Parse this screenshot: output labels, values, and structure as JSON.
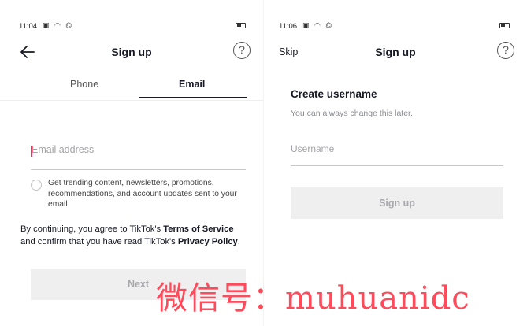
{
  "left_screen": {
    "status": {
      "time": "11:04",
      "icons": "▣ ◠ ⌬"
    },
    "header": {
      "title": "Sign up",
      "help_symbol": "?"
    },
    "tabs": [
      {
        "label": "Phone"
      },
      {
        "label": "Email"
      }
    ],
    "email": {
      "placeholder": "Email address",
      "value": ""
    },
    "consent": {
      "text": "Get trending content, newsletters, promotions, recommendations, and account updates sent to your email"
    },
    "legal": {
      "prefix": "By continuing, you agree to TikTok's ",
      "terms_link": "Terms of Service",
      "middle": " and confirm that you have read TikTok's ",
      "privacy_link": "Privacy Policy",
      "suffix": "."
    },
    "next_button": "Next"
  },
  "right_screen": {
    "status": {
      "time": "11:06",
      "icons": "▣ ◠ ⌬"
    },
    "header": {
      "skip": "Skip",
      "title": "Sign up",
      "help_symbol": "?"
    },
    "create_title": "Create username",
    "create_subtitle": "You can always change this later.",
    "username": {
      "placeholder": "Username",
      "value": ""
    },
    "signup_button": "Sign up"
  },
  "watermark": "微信号：muhuanidc",
  "colors": {
    "text": "#161823",
    "caret": "#fe2c55",
    "disabled_bg": "#efeff0",
    "disabled_text": "#a8a8ad",
    "watermark": "#ff4a5a"
  }
}
